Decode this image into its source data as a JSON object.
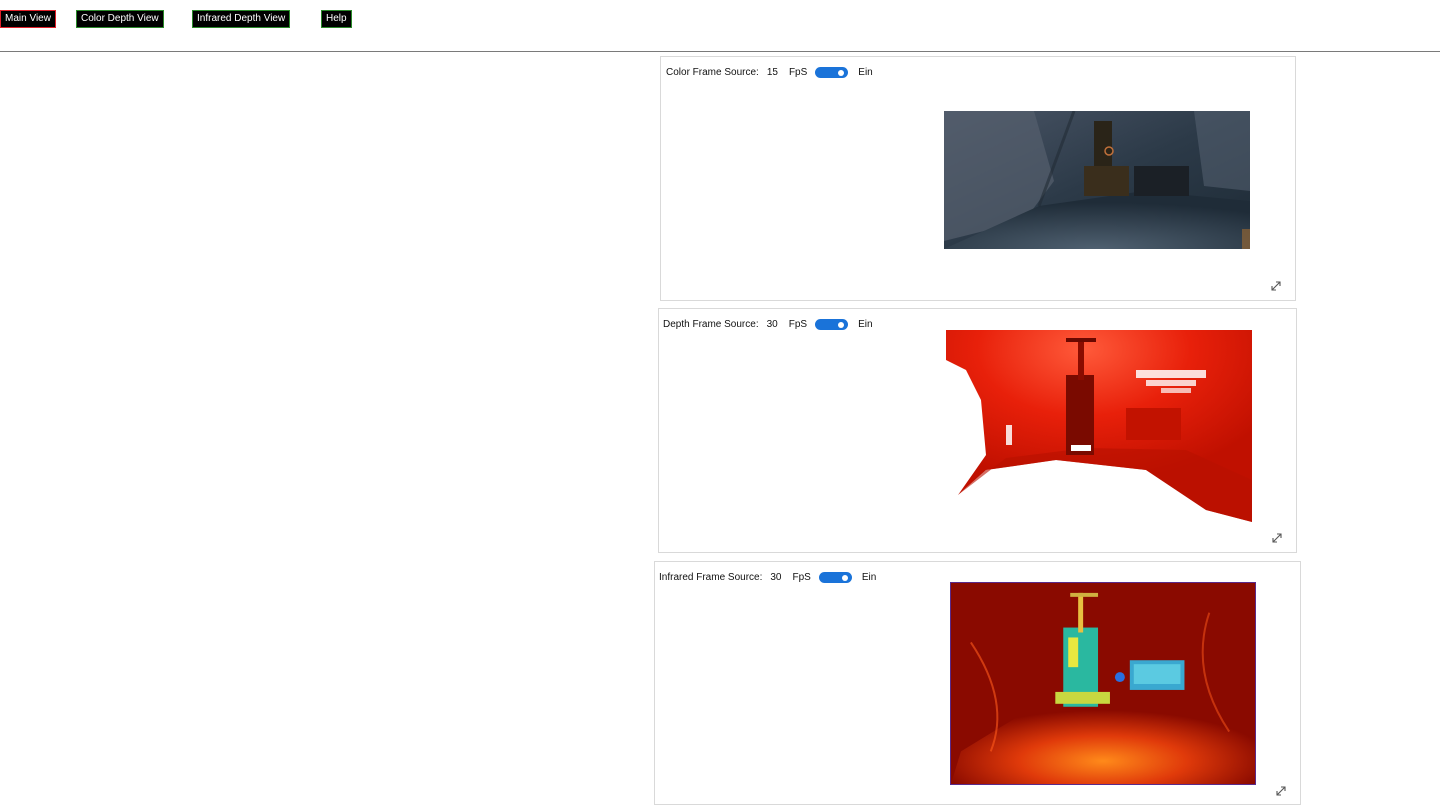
{
  "nav": {
    "main_view": "Main View",
    "color_depth_view": "Color Depth View",
    "infrared_depth_view": "Infrared Depth View",
    "help": "Help"
  },
  "panels": [
    {
      "source_label": "Color Frame Source:",
      "fps_value": "15",
      "fps_unit": "FpS",
      "toggle_state": "Ein",
      "toggle_on": true,
      "frame_icon": "color-camera-frame"
    },
    {
      "source_label": "Depth Frame Source:",
      "fps_value": "30",
      "fps_unit": "FpS",
      "toggle_state": "Ein",
      "toggle_on": true,
      "frame_icon": "depth-camera-frame"
    },
    {
      "source_label": "Infrared Frame Source:",
      "fps_value": "30",
      "fps_unit": "FpS",
      "toggle_state": "Ein",
      "toggle_on": true,
      "frame_icon": "infrared-camera-frame"
    }
  ],
  "icons": {
    "expand": "expand-icon"
  },
  "colors": {
    "toggle_on": "#1a73d9",
    "active_nav_border": "#e0202a",
    "nav_border": "#2a8a2a"
  }
}
